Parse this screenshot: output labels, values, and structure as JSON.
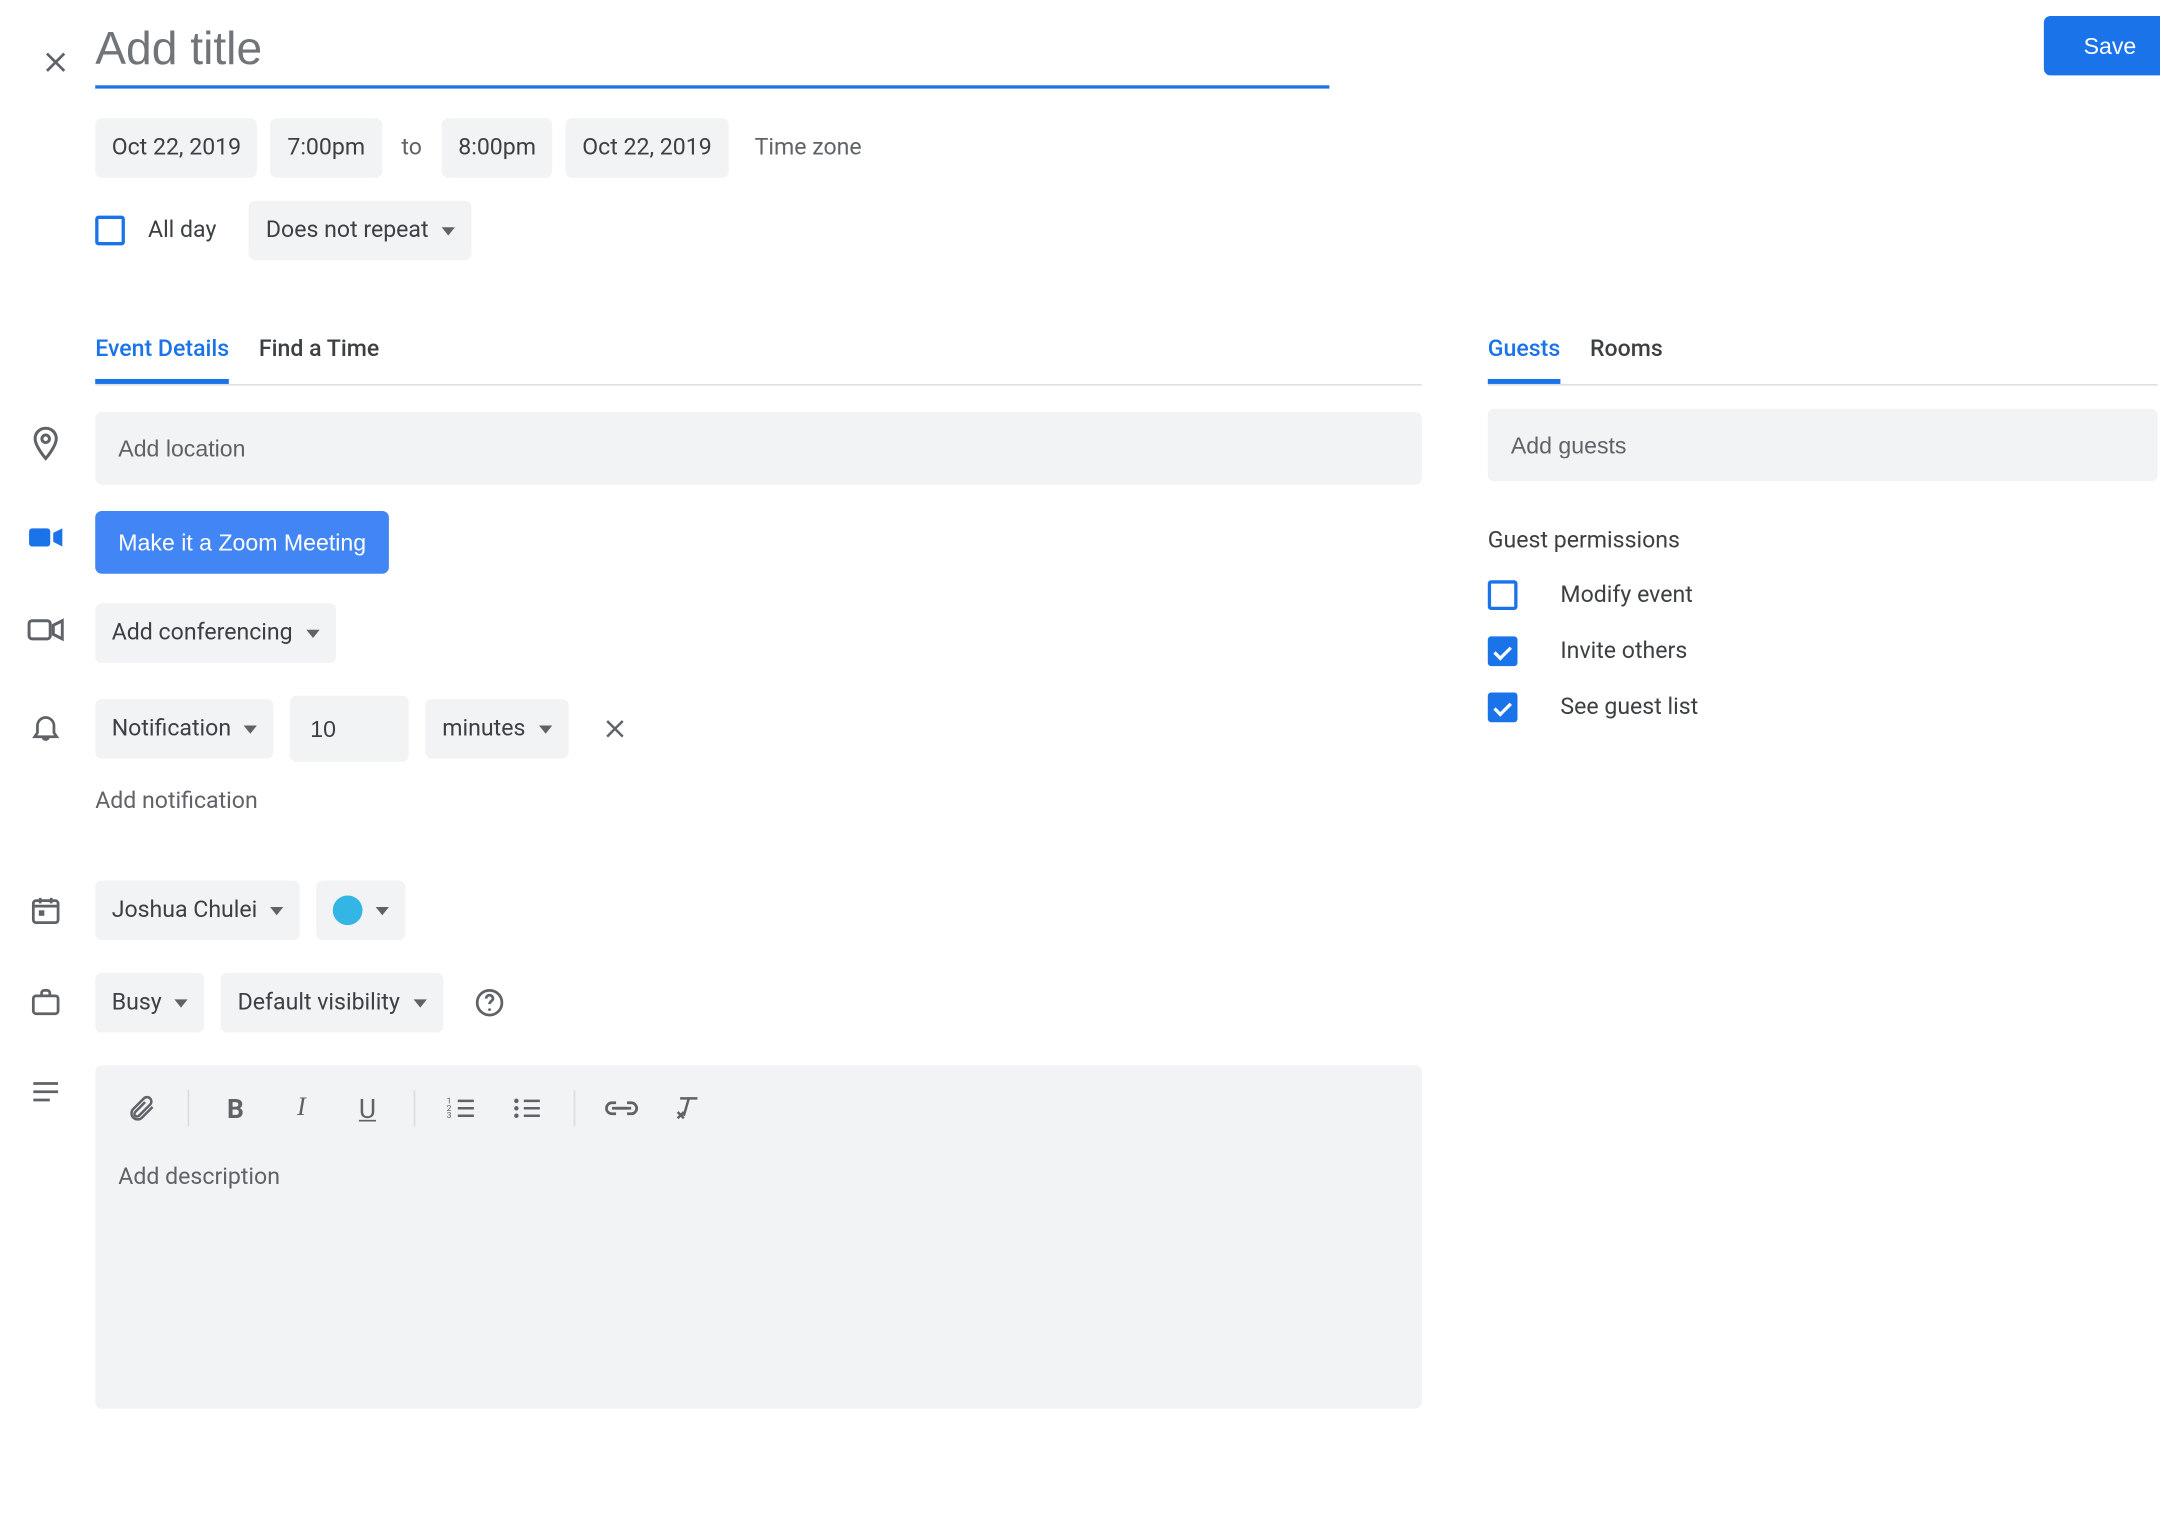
{
  "header": {
    "title_placeholder": "Add title",
    "save_label": "Save"
  },
  "datetime": {
    "start_date": "Oct 22, 2019",
    "start_time": "7:00pm",
    "to_word": "to",
    "end_time": "8:00pm",
    "end_date": "Oct 22, 2019",
    "timezone_link": "Time zone",
    "all_day_label": "All day",
    "repeat_label": "Does not repeat"
  },
  "tabs": {
    "left": [
      "Event Details",
      "Find a Time"
    ],
    "right": [
      "Guests",
      "Rooms"
    ]
  },
  "location": {
    "placeholder": "Add location"
  },
  "zoom_button": "Make it a Zoom Meeting",
  "conferencing_label": "Add conferencing",
  "notification": {
    "type_label": "Notification",
    "value": "10",
    "unit_label": "minutes",
    "add_label": "Add notification"
  },
  "calendar": {
    "owner": "Joshua Chulei",
    "color": "#33b5e5"
  },
  "availability": {
    "busy_label": "Busy",
    "visibility_label": "Default visibility"
  },
  "description": {
    "placeholder": "Add description"
  },
  "guests": {
    "placeholder": "Add guests",
    "permissions_header": "Guest permissions",
    "perm_modify": "Modify event",
    "perm_invite": "Invite others",
    "perm_seelist": "See guest list"
  }
}
